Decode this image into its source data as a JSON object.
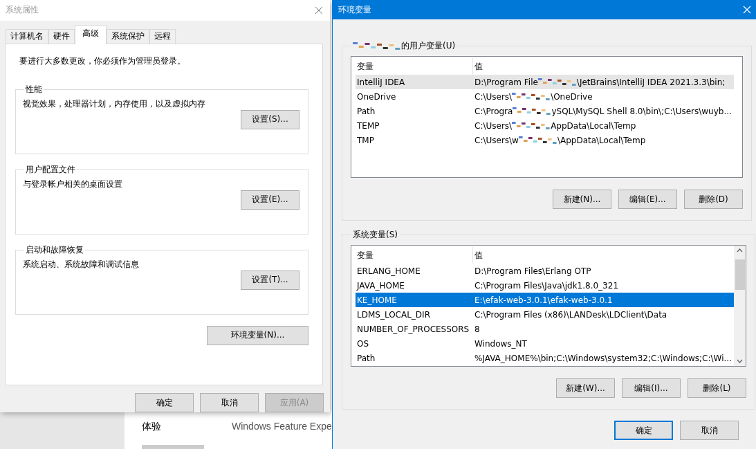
{
  "background_window": {
    "rows": [
      {
        "label": "体验",
        "value": "Windows Feature Expe"
      }
    ]
  },
  "system_properties": {
    "title": "系统属性",
    "tabs": [
      {
        "label": "计算机名",
        "selected": false
      },
      {
        "label": "硬件",
        "selected": false
      },
      {
        "label": "高级",
        "selected": true
      },
      {
        "label": "系统保护",
        "selected": false
      },
      {
        "label": "远程",
        "selected": false
      }
    ],
    "notice": "要进行大多数更改，你必须作为管理员登录。",
    "groups": [
      {
        "title": "性能",
        "description": "视觉效果，处理器计划，内存使用，以及虚拟内存",
        "button": "设置(S)..."
      },
      {
        "title": "用户配置文件",
        "description": "与登录帐户相关的桌面设置",
        "button": "设置(E)..."
      },
      {
        "title": "启动和故障恢复",
        "description": "系统启动、系统故障和调试信息",
        "button": "设置(T)..."
      }
    ],
    "env_button": "环境变量(N)...",
    "buttons": [
      {
        "label": "确定",
        "disabled": false
      },
      {
        "label": "取消",
        "disabled": false
      },
      {
        "label": "应用(A)",
        "disabled": true
      }
    ]
  },
  "environment_variables": {
    "title": "环境变量",
    "sections": [
      {
        "label": "的用户变量(U)",
        "label_redacted": true,
        "focused": false,
        "scrollbar": false,
        "columns": [
          "变量",
          "值"
        ],
        "rows": [
          {
            "name": "IntelliJ IDEA",
            "value": "D:\\Program File",
            "redacted": true,
            "value_after": "\\JetBrains\\IntelliJ IDEA 2021.3.3\\bin;",
            "selected": true
          },
          {
            "name": "OneDrive",
            "value": "C:\\Users\\",
            "redacted": true,
            "value_after": "\\OneDrive",
            "selected": false
          },
          {
            "name": "Path",
            "value": "C:\\Progra",
            "redacted": true,
            "value_after": "ySQL\\MySQL Shell 8.0\\bin\\;C:\\Users\\wuyb...",
            "selected": false
          },
          {
            "name": "TEMP",
            "value": "C:\\Users\\",
            "redacted": true,
            "value_after": "AppData\\Local\\Temp",
            "selected": false
          },
          {
            "name": "TMP",
            "value": "C:\\Users\\w",
            "redacted": true,
            "value_after": "\\AppData\\Local\\Temp",
            "selected": false
          }
        ],
        "buttons": [
          "新建(N)...",
          "编辑(E)...",
          "删除(D)"
        ]
      },
      {
        "label": "系统变量(S)",
        "label_redacted": false,
        "focused": true,
        "scrollbar": true,
        "columns": [
          "变量",
          "值"
        ],
        "rows": [
          {
            "name": "ERLANG_HOME",
            "value": "D:\\Program Files\\Erlang OTP",
            "redacted": false,
            "selected": false
          },
          {
            "name": "JAVA_HOME",
            "value": "C:\\Program Files\\Java\\jdk1.8.0_321",
            "redacted": false,
            "selected": false
          },
          {
            "name": "KE_HOME",
            "value": "E:\\efak-web-3.0.1\\efak-web-3.0.1",
            "redacted": false,
            "selected": true
          },
          {
            "name": "LDMS_LOCAL_DIR",
            "value": "C:\\Program Files (x86)\\LANDesk\\LDClient\\Data",
            "redacted": false,
            "selected": false
          },
          {
            "name": "NUMBER_OF_PROCESSORS",
            "value": "8",
            "redacted": false,
            "selected": false
          },
          {
            "name": "OS",
            "value": "Windows_NT",
            "redacted": false,
            "selected": false
          },
          {
            "name": "Path",
            "value": "%JAVA_HOME%\\bin;C:\\Windows\\system32;C:\\Windows;C:\\Wi...",
            "redacted": false,
            "selected": false
          }
        ],
        "buttons": [
          "新建(W)...",
          "编辑(I)...",
          "删除(L)"
        ]
      }
    ],
    "buttons": [
      {
        "label": "确定",
        "default": true
      },
      {
        "label": "取消",
        "default": false
      }
    ]
  }
}
